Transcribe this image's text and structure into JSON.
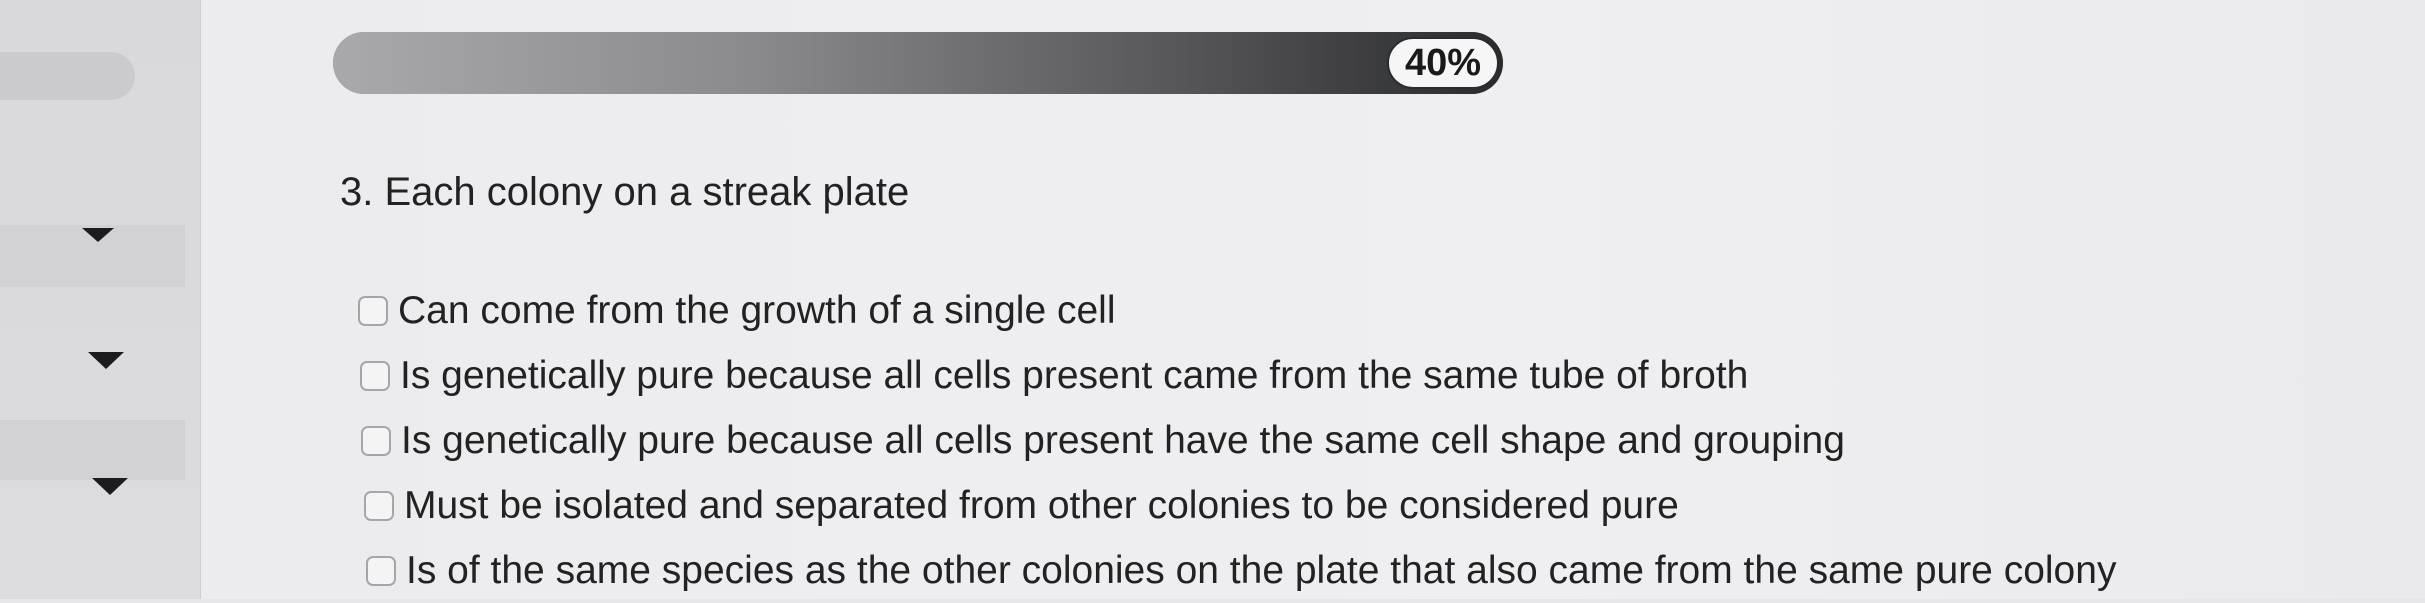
{
  "progress": {
    "value_percent": 40,
    "label": "40%"
  },
  "sidebar": {
    "items": [
      {
        "icon": "chevron-down-icon"
      },
      {
        "icon": "chevron-down-icon"
      },
      {
        "icon": "chevron-down-icon"
      }
    ]
  },
  "question": {
    "text": "3. Each colony on a streak plate",
    "options": [
      {
        "label": "Can come from the growth of a single cell",
        "checked": false
      },
      {
        "label": "Is genetically pure because all cells present came from the same tube of broth",
        "checked": false
      },
      {
        "label": "Is genetically pure because all cells present have the same cell shape and grouping",
        "checked": false
      },
      {
        "label": "Must be isolated and separated from other colonies to be considered pure",
        "checked": false
      },
      {
        "label": "Is of the same species as the other colonies on the plate that also came from the same pure colony",
        "checked": false
      }
    ]
  }
}
